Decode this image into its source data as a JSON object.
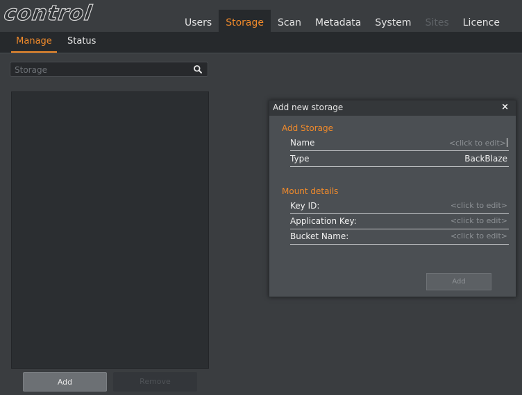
{
  "app": {
    "logo_text": "control"
  },
  "nav": {
    "tabs": [
      {
        "label": "Users"
      },
      {
        "label": "Storage"
      },
      {
        "label": "Scan"
      },
      {
        "label": "Metadata"
      },
      {
        "label": "System"
      },
      {
        "label": "Sites"
      },
      {
        "label": "Licence"
      }
    ],
    "active_tab": "Storage",
    "disabled_tab": "Sites"
  },
  "subnav": {
    "tabs": [
      {
        "label": "Manage"
      },
      {
        "label": "Status"
      }
    ],
    "active_tab": "Manage"
  },
  "sidebar": {
    "search": {
      "placeholder": "Storage",
      "value": ""
    },
    "items": [],
    "add_label": "Add",
    "remove_label": "Remove"
  },
  "dialog": {
    "title": "Add new storage",
    "close_glyph": "×",
    "sections": {
      "add_storage": {
        "heading": "Add Storage",
        "name": {
          "label": "Name",
          "value": "<click to edit>"
        },
        "type": {
          "label": "Type",
          "value": "BackBlaze"
        }
      },
      "mount": {
        "heading": "Mount details",
        "key_id": {
          "label": "Key ID:",
          "value": "<click to edit>"
        },
        "application_key": {
          "label": "Application Key:",
          "value": "<click to edit>"
        },
        "bucket_name": {
          "label": "Bucket Name:",
          "value": "<click to edit>"
        }
      }
    },
    "add_label": "Add"
  },
  "colors": {
    "accent": "#f08a2b",
    "background": "#3a3d40",
    "panel": "#2b2e31",
    "dialog": "#4b4f53"
  },
  "icons": {
    "search": "search-icon",
    "close": "close-icon"
  }
}
